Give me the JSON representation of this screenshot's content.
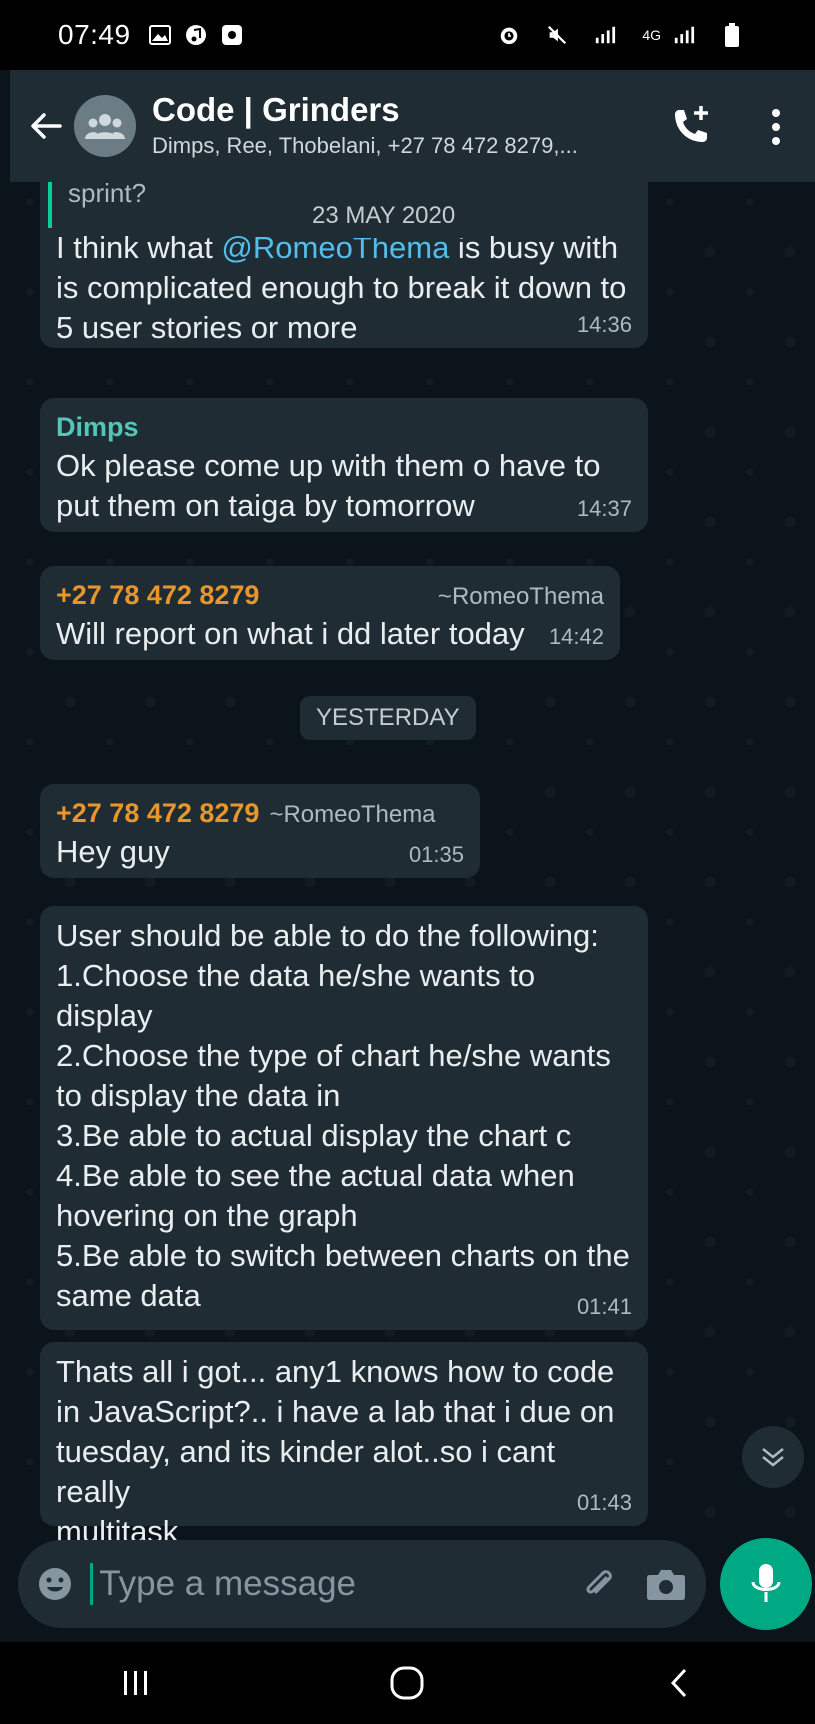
{
  "status_bar": {
    "time": "07:49",
    "network": "4G"
  },
  "header": {
    "group_name": "Code | Grinders",
    "members": "Dimps, Ree, Thobelani, +27 78 472 8279,..."
  },
  "chat": {
    "quoted_snippet": "sprint?",
    "date_pill_1": "23 MAY 2020",
    "messages": [
      {
        "text_before": "I think what ",
        "mention": "@RomeoThema",
        "text_after": " is busy with\nis complicated enough to break it down to\n5 user stories or more",
        "time": "14:36"
      },
      {
        "sender": "Dimps",
        "text": "Ok please come up with them o have to\nput them on taiga by tomorrow",
        "time": "14:37"
      },
      {
        "sender": "+27 78 472 8279",
        "alias": "~RomeoThema",
        "text": "Will report on what i dd later today",
        "time": "14:42"
      },
      {
        "sender": "+27 78 472 8279",
        "alias": "~RomeoThema",
        "text": "Hey guy",
        "time": "01:35"
      },
      {
        "text": "User should be able to do the following:\n1.Choose the data he/she wants to\ndisplay\n2.Choose the type of chart he/she wants\nto display the data in\n3.Be able to actual display the chart c\n4.Be able to see the actual data when\nhovering on the graph\n5.Be able to switch between charts on the\nsame data",
        "time": "01:41"
      },
      {
        "text": "Thats all i got... any1 knows how to code\nin JavaScript?.. i have a lab that i due on\ntuesday, and its kinder alot..so i cant really\nmultitask",
        "time": "01:43"
      }
    ],
    "date_pill_2": "YESTERDAY"
  },
  "input": {
    "placeholder": "Type a message"
  },
  "colors": {
    "accent": "#00a884",
    "sender_orange": "#e8962b",
    "sender_teal": "#52c7b8",
    "mention": "#53bdeb"
  }
}
